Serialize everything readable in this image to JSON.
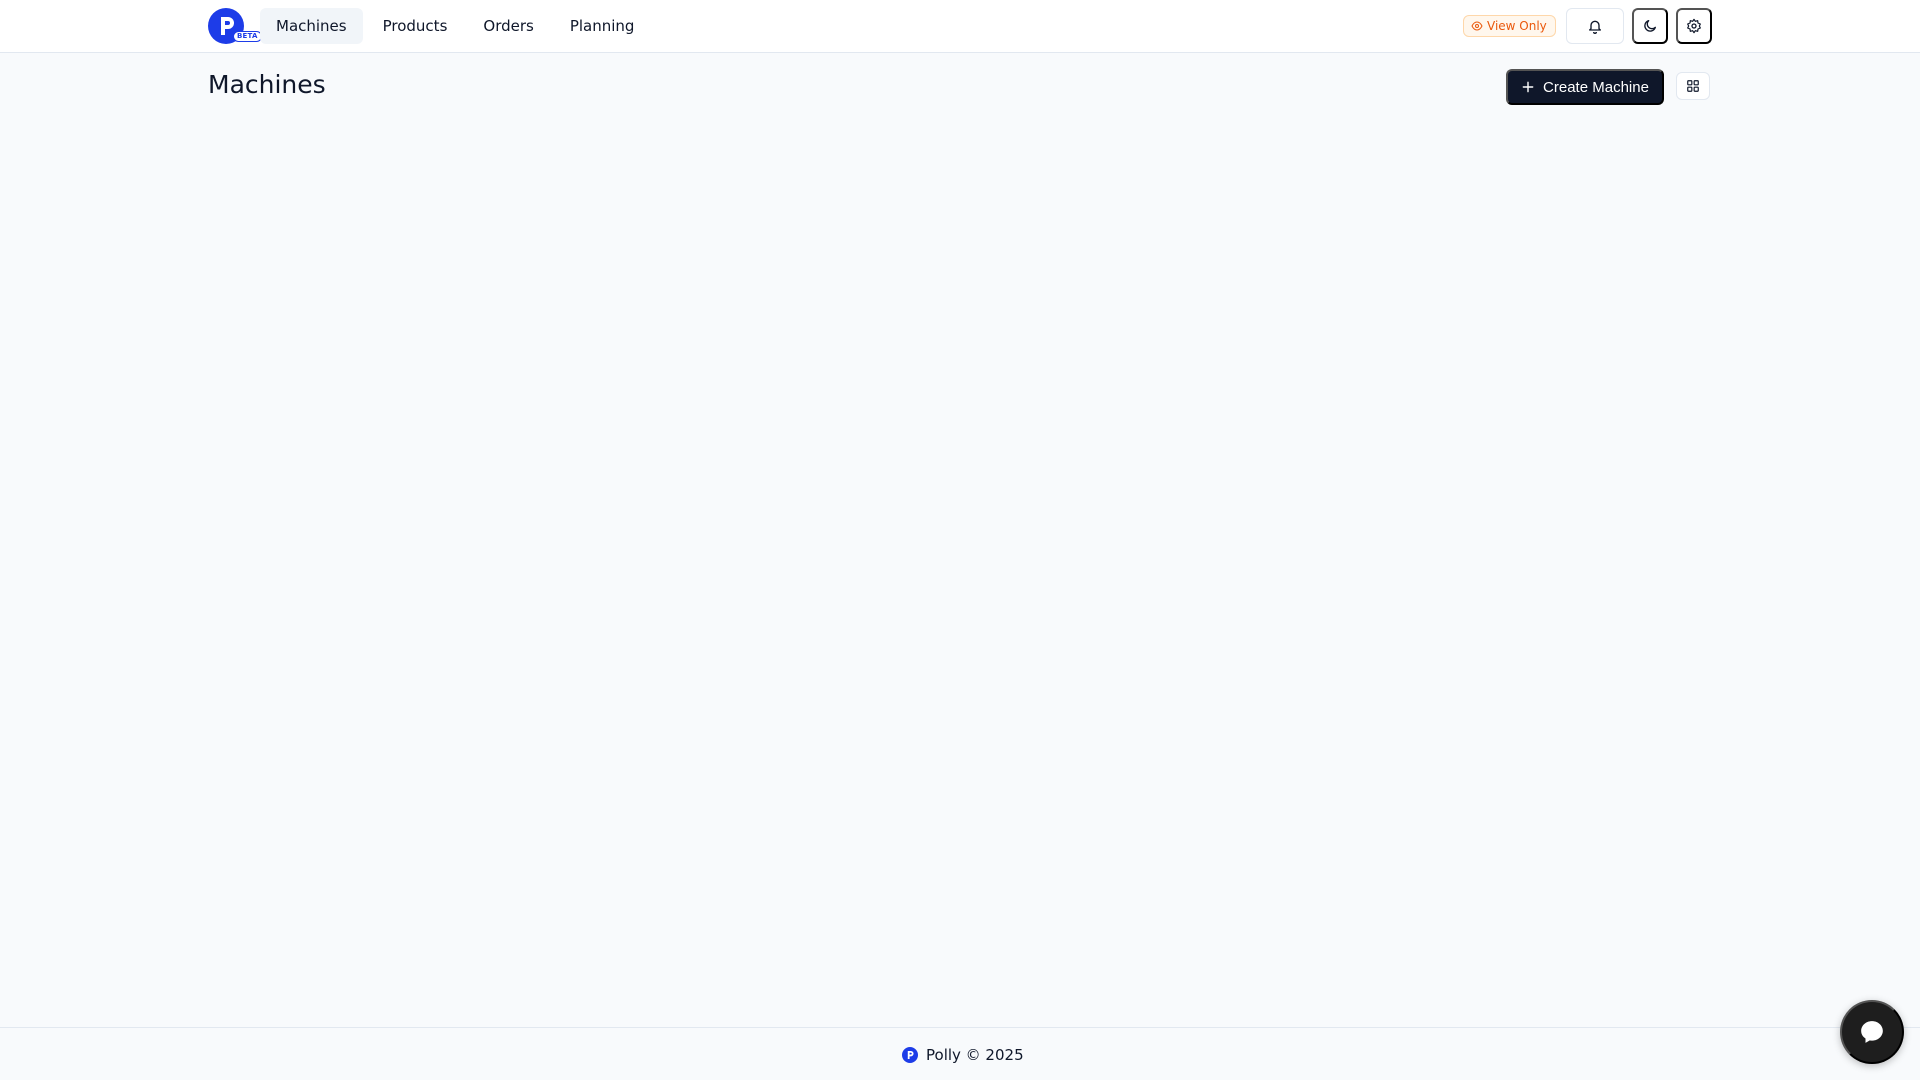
{
  "header": {
    "logo_badge": "BETA",
    "nav": [
      {
        "label": "Machines",
        "active": true
      },
      {
        "label": "Products",
        "active": false
      },
      {
        "label": "Orders",
        "active": false
      },
      {
        "label": "Planning",
        "active": false
      }
    ],
    "view_only_label": "View Only",
    "icons": {
      "bell": "bell-icon",
      "moon": "moon-icon",
      "gear": "gear-icon",
      "eye": "eye-icon"
    }
  },
  "main": {
    "title": "Machines",
    "create_button_label": "Create Machine",
    "view_toggle_icon": "grid-icon"
  },
  "footer": {
    "text": "Polly © 2025"
  },
  "chat": {
    "icon": "chat-bubble-icon"
  },
  "colors": {
    "brand": "#1d3ce8",
    "primary_button": "#0f172a",
    "view_only_text": "#ea580c",
    "view_only_bg": "#fff7ed",
    "page_bg": "#f8fafc"
  }
}
